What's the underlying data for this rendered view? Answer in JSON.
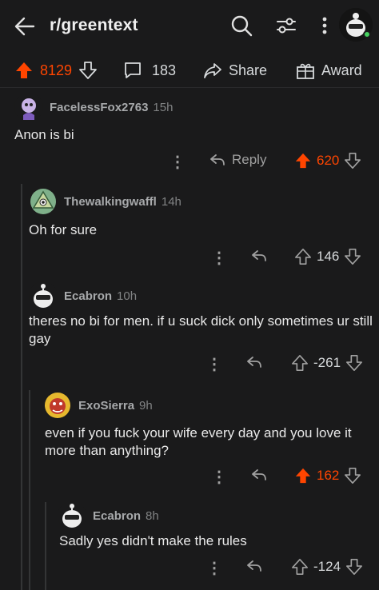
{
  "header": {
    "title": "r/greentext"
  },
  "post_actions": {
    "score": "8129",
    "comments": "183",
    "share_label": "Share",
    "award_label": "Award"
  },
  "comments": [
    {
      "user": "FacelessFox2763",
      "time": "15h",
      "body": "Anon is bi",
      "reply_label": "Reply",
      "score": "620",
      "upvoted": true
    },
    {
      "user": "Thewalkingwaffl",
      "time": "14h",
      "body": "Oh for sure",
      "score": "146",
      "upvoted": false
    },
    {
      "user": "Ecabron",
      "time": "10h",
      "body": "theres no bi for men. if u suck dick only sometimes ur still gay",
      "score": "-261",
      "upvoted": false
    },
    {
      "user": "ExoSierra",
      "time": "9h",
      "body": "even if you fuck your wife every day and you love it more than anything?",
      "score": "162",
      "upvoted": true
    },
    {
      "user": "Ecabron",
      "time": "8h",
      "body": "Sadly yes didn't make the rules",
      "score": "-124",
      "upvoted": false
    }
  ],
  "colors": {
    "upvote": "#ff4500",
    "background": "#1a1a1b",
    "muted": "#818384"
  },
  "icons": [
    "back-arrow-icon",
    "search-icon",
    "filter-icon",
    "more-vert-icon",
    "upvote-icon",
    "downvote-icon",
    "comment-icon",
    "share-icon",
    "award-icon",
    "reply-icon"
  ]
}
